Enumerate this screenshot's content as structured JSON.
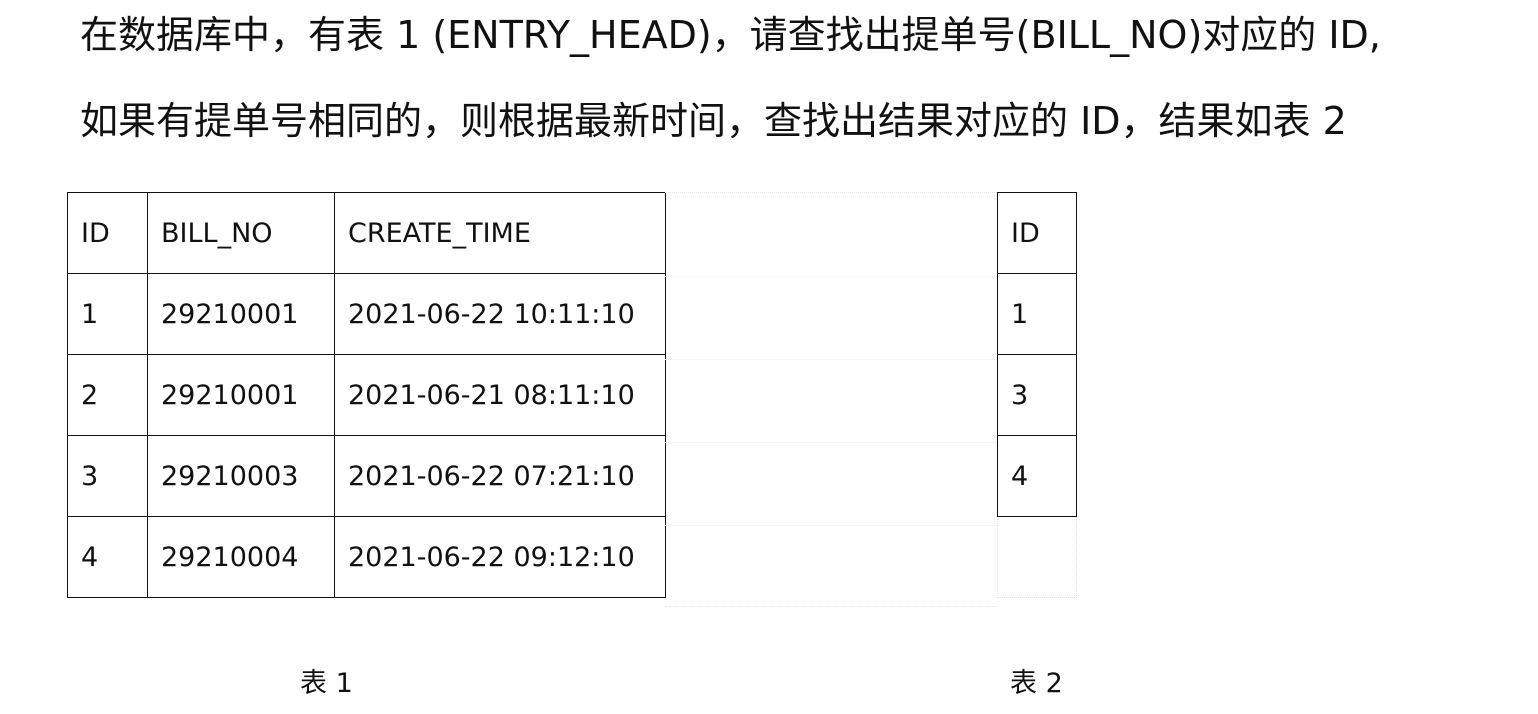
{
  "question": {
    "line1": "在数据库中，有表 1 (ENTRY_HEAD)，请查找出提单号(BILL_NO)对应的 ID,",
    "line2": "如果有提单号相同的，则根据最新时间，查找出结果对应的 ID，结果如表 2"
  },
  "table1": {
    "headers": [
      "ID",
      "BILL_NO",
      "CREATE_TIME"
    ],
    "rows": [
      [
        "1",
        "29210001",
        "2021-06-22 10:11:10"
      ],
      [
        "2",
        "29210001",
        "2021-06-21 08:11:10"
      ],
      [
        "3",
        "29210003",
        "2021-06-22 07:21:10"
      ],
      [
        "4",
        "29210004",
        "2021-06-22 09:12:10"
      ]
    ],
    "caption": "表 1"
  },
  "table2": {
    "header": "ID",
    "rows": [
      "1",
      "3",
      "4"
    ],
    "caption": "表 2"
  }
}
